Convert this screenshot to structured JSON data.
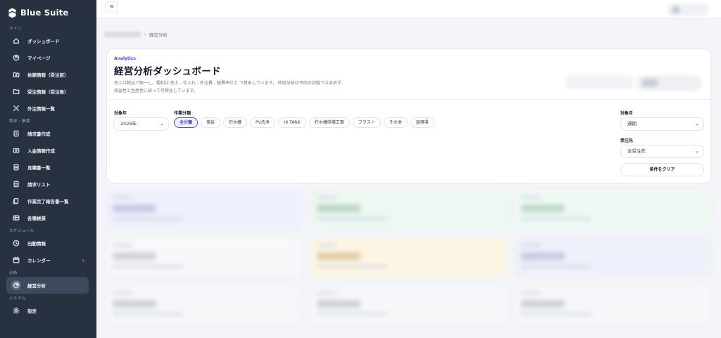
{
  "app": {
    "name": "Blue Suite"
  },
  "colors": {
    "sidebar": "#273140",
    "accent": "#4f46e5",
    "active_chip_bg": "#eef1fe"
  },
  "sidebar": {
    "sections": [
      {
        "title": "メイン",
        "items": [
          {
            "label": "ダッシュボード",
            "icon": "home-icon"
          },
          {
            "label": "マイページ",
            "icon": "user-circle-icon"
          },
          {
            "label": "依頼情報（受注前）",
            "icon": "folder-download-icon"
          },
          {
            "label": "受注情報（受注後）",
            "icon": "folder-icon"
          },
          {
            "label": "外注情報一覧",
            "icon": "tools-icon"
          }
        ]
      },
      {
        "title": "請求・帳票",
        "items": [
          {
            "label": "請求書作成",
            "icon": "invoice-icon"
          },
          {
            "label": "入金情報作成",
            "icon": "payment-icon"
          },
          {
            "label": "見積書一覧",
            "icon": "document-icon"
          },
          {
            "label": "請求リスト",
            "icon": "list-icon"
          },
          {
            "label": "作業完了報告書一覧",
            "icon": "report-icon"
          },
          {
            "label": "各種帳票",
            "icon": "table-icon"
          }
        ]
      },
      {
        "title": "スケジュール",
        "items": [
          {
            "label": "出勤情報",
            "icon": "clock-icon"
          },
          {
            "label": "カレンダー",
            "icon": "calendar-icon",
            "chevron": "›"
          }
        ]
      },
      {
        "title": "分析",
        "items": [
          {
            "label": "経営分析",
            "icon": "chart-pie-icon",
            "active": true
          }
        ]
      },
      {
        "title": "システム",
        "items": [
          {
            "label": "設定",
            "icon": "gear-icon"
          }
        ]
      }
    ]
  },
  "header": {
    "collapse_icon": "«"
  },
  "breadcrumb": {
    "separator": "›",
    "current": "経営分析"
  },
  "card": {
    "eyebrow": "Analytics",
    "title": "経営分析ダッシュボード",
    "desc_line1": "売上は税込で統一し、粗利は 売上 - 仕入れ - 外注費 - 経費率計上 で算出しています。 回収分析は今回の初版では含めず、",
    "desc_line2": "収益性と生産性に絞って可視化しています。"
  },
  "filters": {
    "year_label": "対象年",
    "year_value": "2026年",
    "category_label": "作業分類",
    "chips": [
      "全分類",
      "美装",
      "貯水槽",
      "PV洗浄",
      "HI TANK",
      "貯水槽俳補工事",
      "ブラスト",
      "その他",
      "直現場"
    ],
    "active_chip": 0,
    "month_label": "対象月",
    "month_value": "通期",
    "client_label": "受注先",
    "client_value": "全受注先",
    "clear_label": "条件をクリア"
  }
}
